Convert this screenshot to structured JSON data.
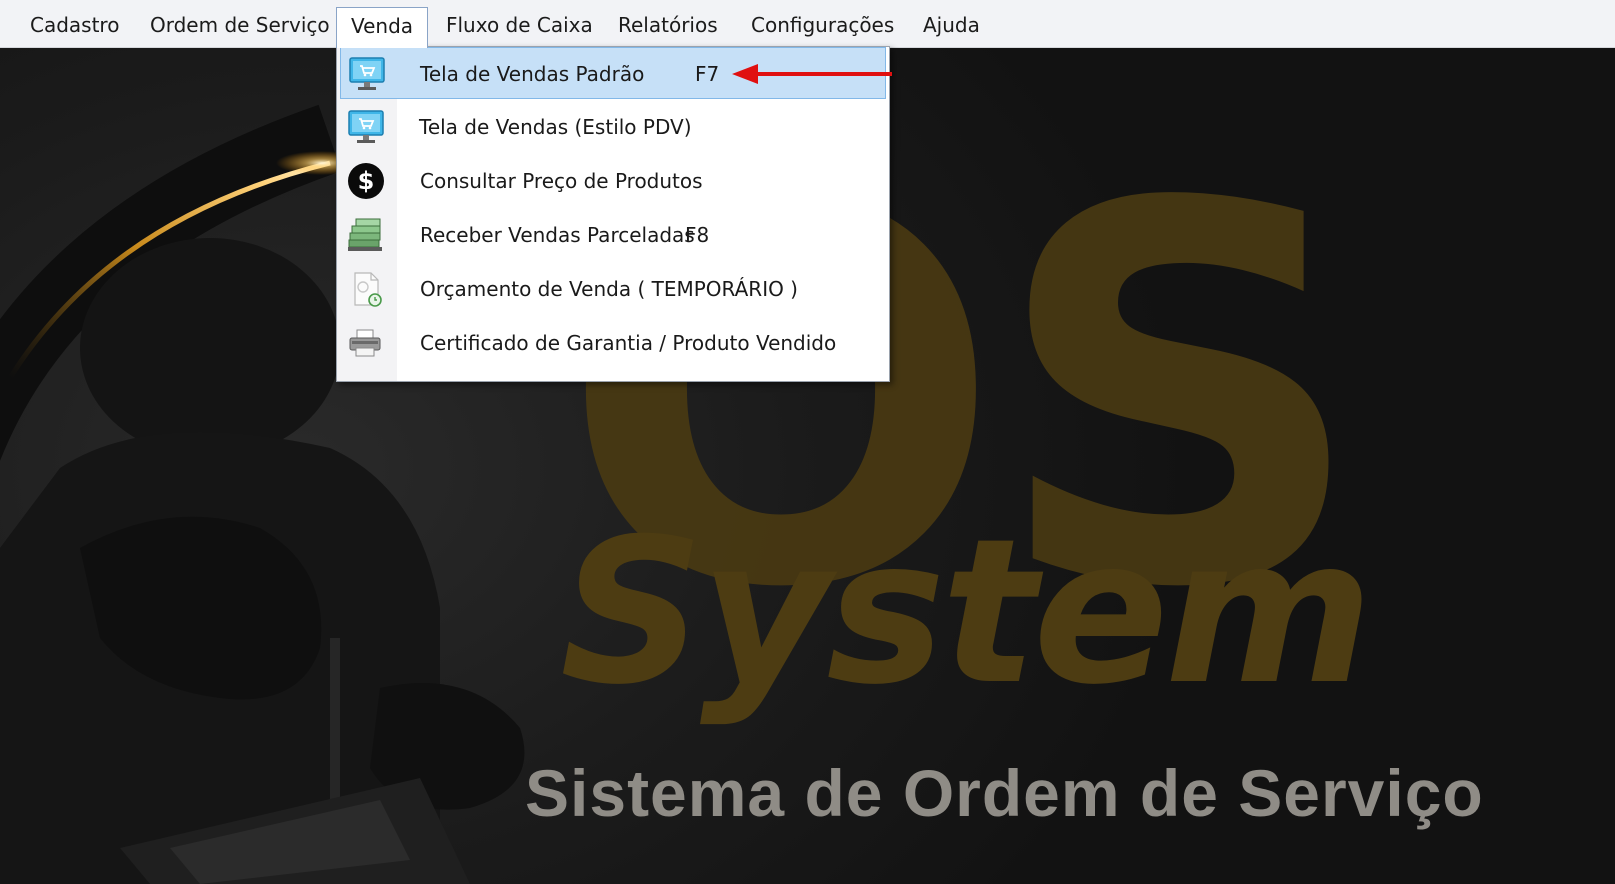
{
  "menubar": {
    "items": [
      {
        "label": "Cadastro"
      },
      {
        "label": "Ordem de Serviço"
      },
      {
        "label": "Venda"
      },
      {
        "label": "Fluxo de Caixa"
      },
      {
        "label": "Relatórios"
      },
      {
        "label": "Configurações"
      },
      {
        "label": "Ajuda"
      }
    ]
  },
  "venda_menu": {
    "items": [
      {
        "label": "Tela de Vendas Padrão",
        "shortcut": "F7",
        "icon": "monitor-cart-icon"
      },
      {
        "label": "Tela de Vendas (Estilo PDV)",
        "shortcut": "",
        "icon": "monitor-cart-icon"
      },
      {
        "label": "Consultar Preço de Produtos",
        "shortcut": "",
        "icon": "dollar-icon"
      },
      {
        "label": "Receber Vendas Parceladas",
        "shortcut": "F8",
        "icon": "money-stack-icon"
      },
      {
        "label": "Orçamento de Venda ( TEMPORÁRIO )",
        "shortcut": "",
        "icon": "document-clock-icon"
      },
      {
        "label": "Certificado de Garantia / Produto Vendido",
        "shortcut": "",
        "icon": "printer-icon"
      }
    ]
  },
  "splash": {
    "logo_top": "OS",
    "logo_bottom": "System",
    "subtitle": "Sistema de Ordem de Serviço"
  },
  "colors": {
    "highlight": "#c6e0f7",
    "arrow": "#e01010",
    "gold": "#4d3c12"
  }
}
